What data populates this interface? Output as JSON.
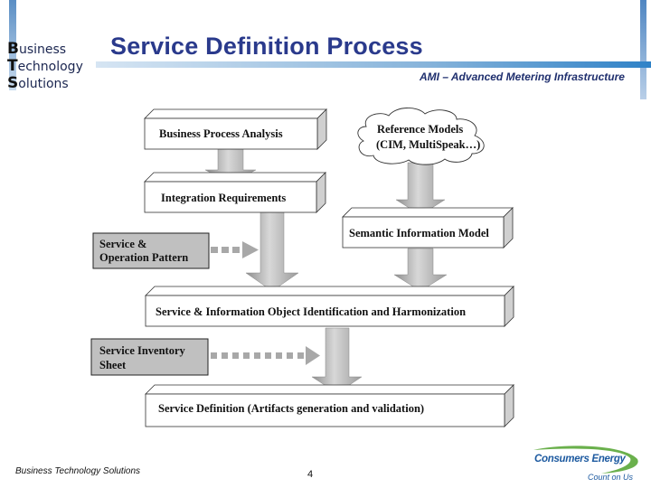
{
  "header": {
    "logo_lines": [
      {
        "cap": "B",
        "rest": "usiness"
      },
      {
        "cap": "T",
        "rest": "echnology"
      },
      {
        "cap": "S",
        "rest": "olutions"
      }
    ],
    "title": "Service Definition Process",
    "subtitle": "AMI – Advanced Metering Infrastructure"
  },
  "diagram": {
    "boxes": {
      "business_process_analysis": "Business Process Analysis",
      "integration_requirements": "Integration Requirements",
      "semantic_information_model": "Semantic Information Model",
      "service_info_object": "Service & Information Object Identification and Harmonization",
      "service_definition": "Service Definition (Artifacts generation and validation)"
    },
    "cloud": {
      "line1": "Reference Models",
      "line2": "(CIM, MultiSpeak…)"
    },
    "inputs": {
      "service_operation_pattern": [
        "Service &",
        "Operation Pattern"
      ],
      "service_inventory_sheet": [
        "Service Inventory",
        "Sheet"
      ]
    }
  },
  "footer": {
    "left_text": "Business Technology Solutions",
    "page_number": "4",
    "brand_name": "Consumers Energy",
    "brand_tagline": "Count on Us"
  },
  "colors": {
    "title": "#2a3a8c",
    "accent_blue": "#2f82c7",
    "input_box_fill": "#c0c0c0",
    "brand_blue": "#1d5aa0",
    "brand_green": "#6ab04c"
  }
}
